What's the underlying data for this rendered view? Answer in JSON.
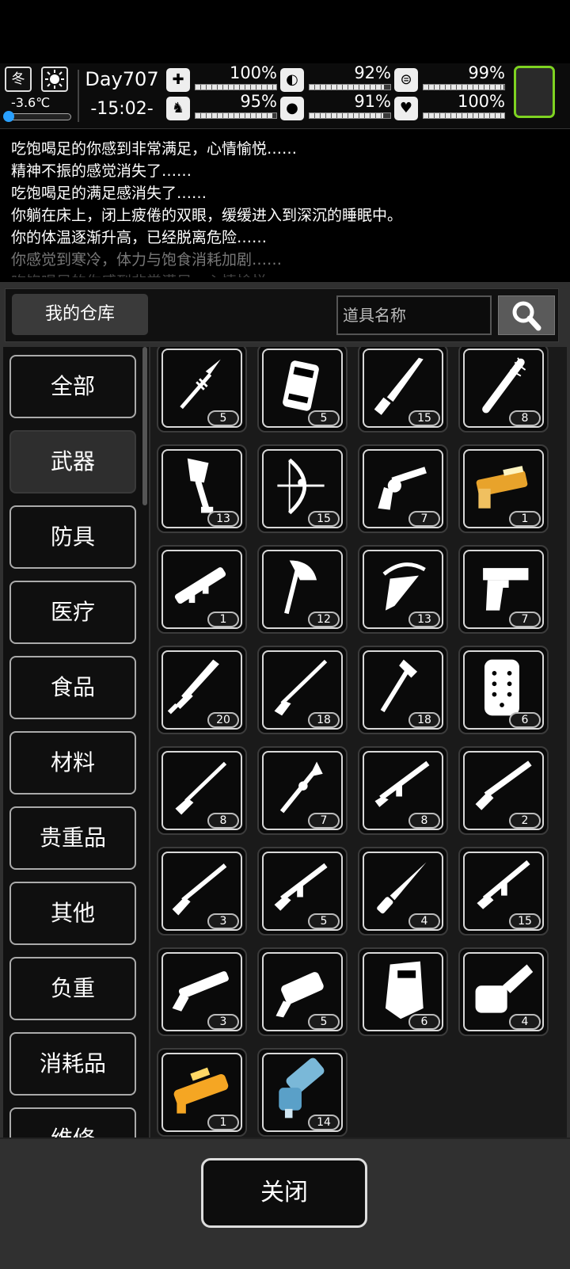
{
  "status": {
    "season": "冬",
    "weather_icon": "sun-icon",
    "temperature": "-3.6℃",
    "temperature_level": 0.1,
    "day": "Day707",
    "time": "-15:02-",
    "stats": [
      {
        "name": "health",
        "icon": "medkit-icon",
        "value": "100%",
        "level": 1.0
      },
      {
        "name": "hunger",
        "icon": "stomach-icon",
        "value": "92%",
        "level": 0.92
      },
      {
        "name": "energy",
        "icon": "lungs-icon",
        "value": "99%",
        "level": 0.99
      },
      {
        "name": "stamina",
        "icon": "boot-icon",
        "value": "95%",
        "level": 0.95
      },
      {
        "name": "thirst",
        "icon": "water-drop-icon",
        "value": "91%",
        "level": 0.91
      },
      {
        "name": "mood",
        "icon": "heart-icon",
        "value": "100%",
        "level": 1.0
      }
    ],
    "accent_color": "#7ed321"
  },
  "log": [
    "吃饱喝足的你感到非常满足，心情愉悦……",
    "精神不振的感觉消失了……",
    "吃饱喝足的满足感消失了……",
    "你躺在床上，闭上疲倦的双眼，缓缓进入到深沉的睡眠中。",
    "你的体温逐渐升高，已经脱离危险……",
    "你感觉到寒冷，体力与饱食消耗加剧……",
    "吃饱喝足的你感到非常满足，心情愉悦……"
  ],
  "header": {
    "title": "我的仓库",
    "search_placeholder": "道具名称"
  },
  "categories": [
    "全部",
    "武器",
    "防具",
    "医疗",
    "食品",
    "材料",
    "贵重品",
    "其他",
    "负重",
    "消耗品",
    "维修"
  ],
  "active_category": 1,
  "items": [
    {
      "icon": "spear-icon",
      "count": "5"
    },
    {
      "icon": "ammo-crate-icon",
      "count": "5"
    },
    {
      "icon": "machete-icon",
      "count": "15"
    },
    {
      "icon": "spiked-bat-icon",
      "count": "8"
    },
    {
      "icon": "shovel-icon",
      "count": "13"
    },
    {
      "icon": "compound-bow-icon",
      "count": "15"
    },
    {
      "icon": "revolver-icon",
      "count": "7"
    },
    {
      "icon": "gold-shotgun-icon",
      "count": "1"
    },
    {
      "icon": "rocket-launcher-icon",
      "count": "1"
    },
    {
      "icon": "axe-icon",
      "count": "12"
    },
    {
      "icon": "crossbow-icon",
      "count": "13"
    },
    {
      "icon": "desert-eagle-icon",
      "count": "7"
    },
    {
      "icon": "greatsword-icon",
      "count": "20"
    },
    {
      "icon": "hunting-rifle-icon",
      "count": "18"
    },
    {
      "icon": "war-axe-icon",
      "count": "18"
    },
    {
      "icon": "riot-shield-icon",
      "count": "6"
    },
    {
      "icon": "rifle-icon",
      "count": "8"
    },
    {
      "icon": "halberd-icon",
      "count": "7"
    },
    {
      "icon": "assault-rifle-icon",
      "count": "8"
    },
    {
      "icon": "shotgun-icon",
      "count": "2"
    },
    {
      "icon": "bolt-rifle-icon",
      "count": "3"
    },
    {
      "icon": "m16-icon",
      "count": "5"
    },
    {
      "icon": "combat-knife-icon",
      "count": "4"
    },
    {
      "icon": "smg-icon",
      "count": "15"
    },
    {
      "icon": "pump-shotgun-icon",
      "count": "3"
    },
    {
      "icon": "grenade-launcher-icon",
      "count": "5"
    },
    {
      "icon": "ballistic-shield-icon",
      "count": "6"
    },
    {
      "icon": "chainsaw-icon",
      "count": "4"
    },
    {
      "icon": "orange-blaster-icon",
      "count": "1"
    },
    {
      "icon": "minigun-icon",
      "count": "14"
    }
  ],
  "footer": {
    "close_label": "关闭"
  }
}
